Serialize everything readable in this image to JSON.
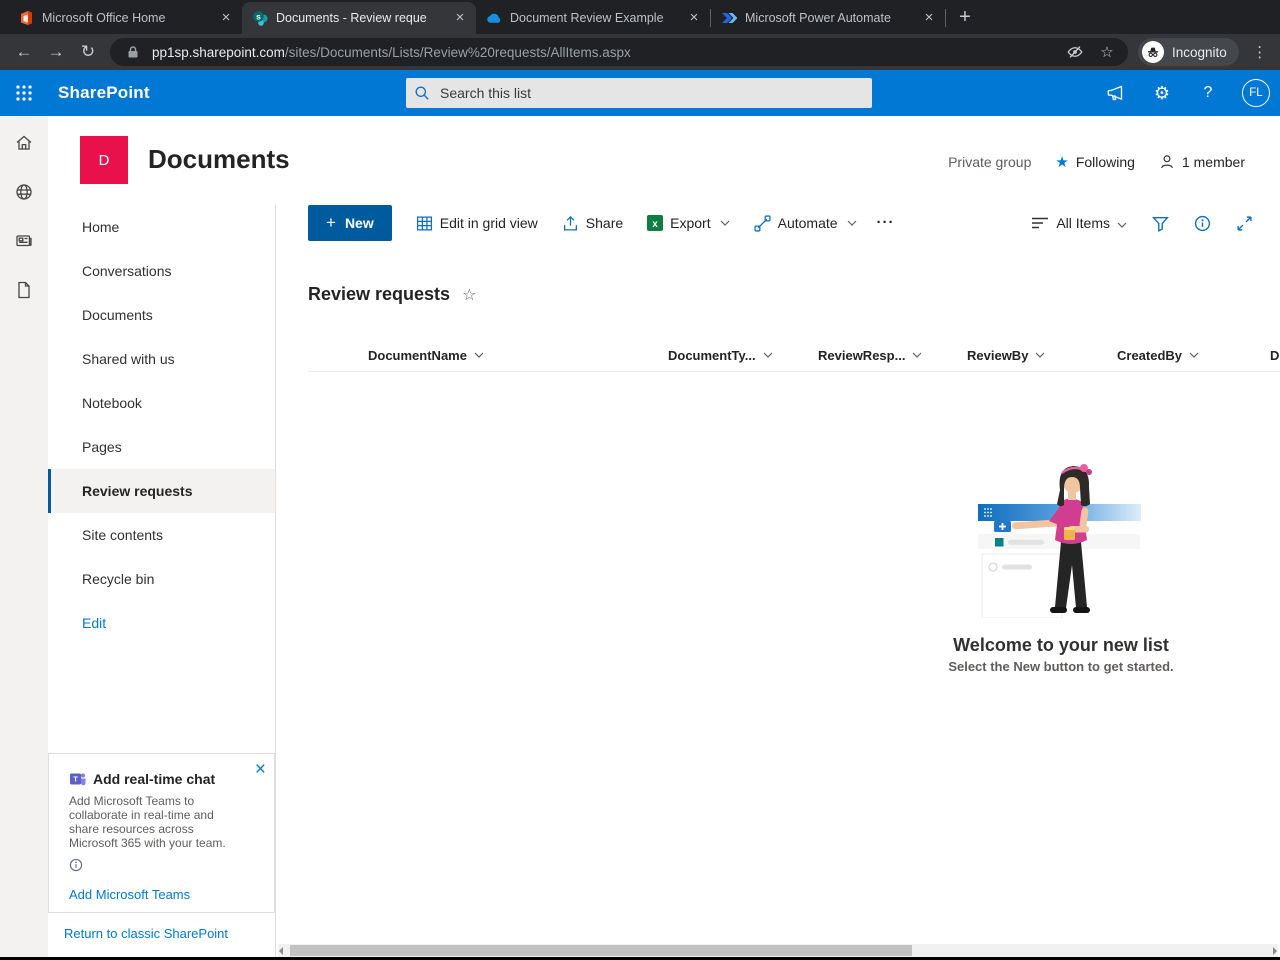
{
  "browser": {
    "tabs": [
      {
        "title": "Microsoft Office Home"
      },
      {
        "title": "Documents - Review reque"
      },
      {
        "title": "Document Review Example"
      },
      {
        "title": "Microsoft Power Automate"
      }
    ],
    "url_host": "pp1sp.sharepoint.com",
    "url_path": "/sites/Documents/Lists/Review%20requests/AllItems.aspx",
    "incognito_label": "Incognito"
  },
  "suite_bar": {
    "brand": "SharePoint",
    "search_placeholder": "Search this list",
    "avatar_initials": "FL"
  },
  "site_header": {
    "logo_letter": "D",
    "title": "Documents",
    "privacy": "Private group",
    "following_label": "Following",
    "members_label": "1 member"
  },
  "nav": {
    "items": [
      "Home",
      "Conversations",
      "Documents",
      "Shared with us",
      "Notebook",
      "Pages",
      "Review requests",
      "Site contents",
      "Recycle bin",
      "Edit"
    ],
    "selected": "Review requests"
  },
  "command_bar": {
    "new_label": "New",
    "edit_grid_label": "Edit in grid view",
    "share_label": "Share",
    "export_label": "Export",
    "automate_label": "Automate",
    "view_label": "All Items"
  },
  "list": {
    "title": "Review requests",
    "columns": [
      "DocumentName",
      "DocumentTy...",
      "ReviewResp...",
      "ReviewBy",
      "CreatedBy",
      "D"
    ]
  },
  "empty_state": {
    "title": "Welcome to your new list",
    "subtitle": "Select the New button to get started."
  },
  "teams_promo": {
    "title": "Add real-time chat",
    "body": "Add Microsoft Teams to collaborate in real-time and share resources across Microsoft 365 with your team.",
    "link": "Add Microsoft Teams"
  },
  "footer": {
    "classic_link": "Return to classic SharePoint"
  },
  "icons": {
    "close": "×",
    "back": "←",
    "forward": "→",
    "reload": "↻",
    "new_tab": "+",
    "menu": "⋮",
    "gear": "⚙",
    "help": "?",
    "plus": "+",
    "more": "···",
    "star_filled": "★",
    "star_outline": "☆"
  },
  "colors": {
    "accent": "#0078d4",
    "accent-dark": "#005a9e",
    "logo": "#e8114b",
    "excel": "#107c41",
    "teams": "#5b5fc7"
  }
}
